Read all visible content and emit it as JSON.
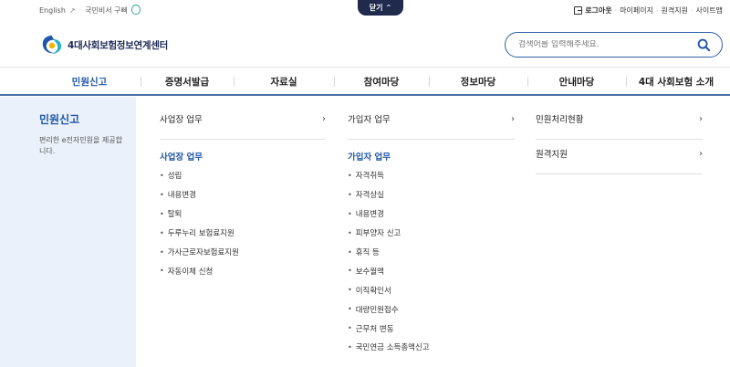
{
  "topbar": {
    "english": "English",
    "kids_link": "국민비서 구삐",
    "close_label": "닫기",
    "logout": "로그아웃",
    "mypage": "마이페이지",
    "remote_support": "원격지원",
    "sitemap": "사이트맵"
  },
  "header": {
    "logo_text": "4대사회보험정보연계센터",
    "search_placeholder": "검색어를 입력해주세요."
  },
  "gnb": {
    "items": [
      "민원신고",
      "증명서발급",
      "자료실",
      "참여마당",
      "정보마당",
      "안내마당",
      "4대 사회보험 소개"
    ],
    "active_index": 0
  },
  "left_panel": {
    "title": "민원신고",
    "description": "편리한 e전자민원을 제공합니다."
  },
  "columns": {
    "col1": {
      "head": "사업장 업무",
      "sub_title": "사업장 업무",
      "items": [
        "성립",
        "내용변경",
        "탈퇴",
        "두루누리 보험료지원",
        "가사근로자보험료지원",
        "자동이체 신청"
      ]
    },
    "col2": {
      "head": "가입자 업무",
      "sub_title": "가입자 업무",
      "items": [
        "자격취득",
        "자격상실",
        "내용변경",
        "피부양자 신고",
        "휴직 등",
        "보수월액",
        "이직확인서",
        "대량민원접수",
        "근무처 변동",
        "국민연금 소득총액신고"
      ]
    },
    "col3": {
      "heads": [
        "민원처리현황",
        "원격지원"
      ]
    }
  },
  "colors": {
    "accent_blue": "#1f56a8",
    "navy": "#1f2a4d",
    "panel_bg": "#eaf1fa"
  }
}
